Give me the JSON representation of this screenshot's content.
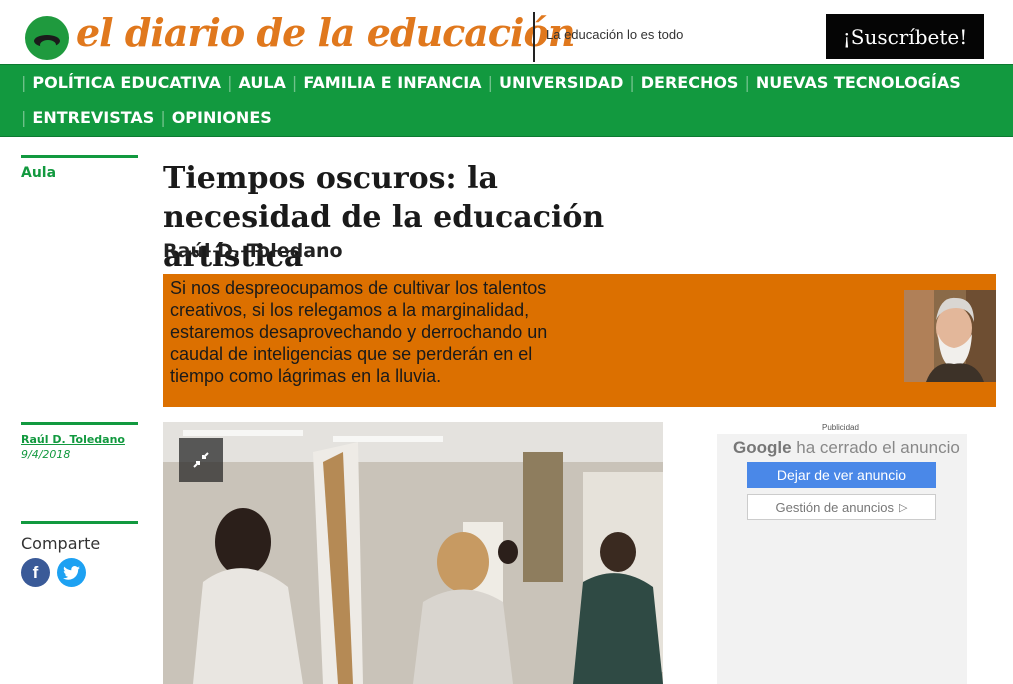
{
  "header": {
    "logo_text": "el diario de la educación",
    "tagline": "La educación lo es todo",
    "subscribe_label": "¡Suscríbete!"
  },
  "nav": {
    "items": [
      {
        "label": "POLÍTICA EDUCATIVA"
      },
      {
        "label": "AULA"
      },
      {
        "label": "FAMILIA E INFANCIA"
      },
      {
        "label": "UNIVERSIDAD"
      },
      {
        "label": "DERECHOS"
      },
      {
        "label": "NUEVAS TECNOLOGÍAS"
      },
      {
        "label": "ENTREVISTAS"
      },
      {
        "label": "OPINIONES"
      }
    ]
  },
  "sidebar": {
    "section": "Aula",
    "author": "Raúl D. Toledano",
    "date": "9/4/2018",
    "share_label": "Comparte",
    "social": [
      {
        "icon": "facebook-icon",
        "glyph": "f"
      },
      {
        "icon": "twitter-icon",
        "glyph": ""
      }
    ]
  },
  "article": {
    "title": "Tiempos oscuros: la necesidad de la educación artística",
    "author": "Raúl D. Toledano",
    "lead": "Si nos despreocupamos de cultivar los talentos creativos, si los relegamos a la marginalidad, estaremos desaprovechando y derrochando un caudal de inteligencias que se perderán en el tiempo como lágrimas en la lluvia.",
    "lead_bg": "#dc7000"
  },
  "ad": {
    "label": "Publicidad",
    "google": "Google",
    "closed_text": "ha cerrado el anuncio",
    "stop_button": "Dejar de ver anuncio",
    "manage_button": "Gestión de anuncios"
  },
  "colors": {
    "brand_green": "#12993f",
    "logo_orange": "#e0781d"
  }
}
